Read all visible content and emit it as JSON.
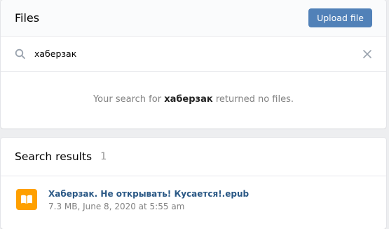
{
  "files_card": {
    "title": "Files",
    "upload_label": "Upload file"
  },
  "search": {
    "query": "хаберзак",
    "placeholder": "",
    "icon": "search-icon",
    "clear_icon": "close-icon"
  },
  "empty_state": {
    "prefix": "Your search for",
    "query": "хаберзак",
    "suffix": "returned no files."
  },
  "results": {
    "title": "Search results",
    "count": "1",
    "items": [
      {
        "name": "Хаберзак. Не открывать! Кусается!.epub",
        "meta": "7.3 MB, June 8, 2020 at 5:55 am",
        "icon": "book-icon",
        "icon_color": "#ffa000"
      }
    ]
  },
  "colors": {
    "accent": "#5181b8",
    "link": "#2a5885",
    "file_icon_bg": "#ffa000"
  }
}
